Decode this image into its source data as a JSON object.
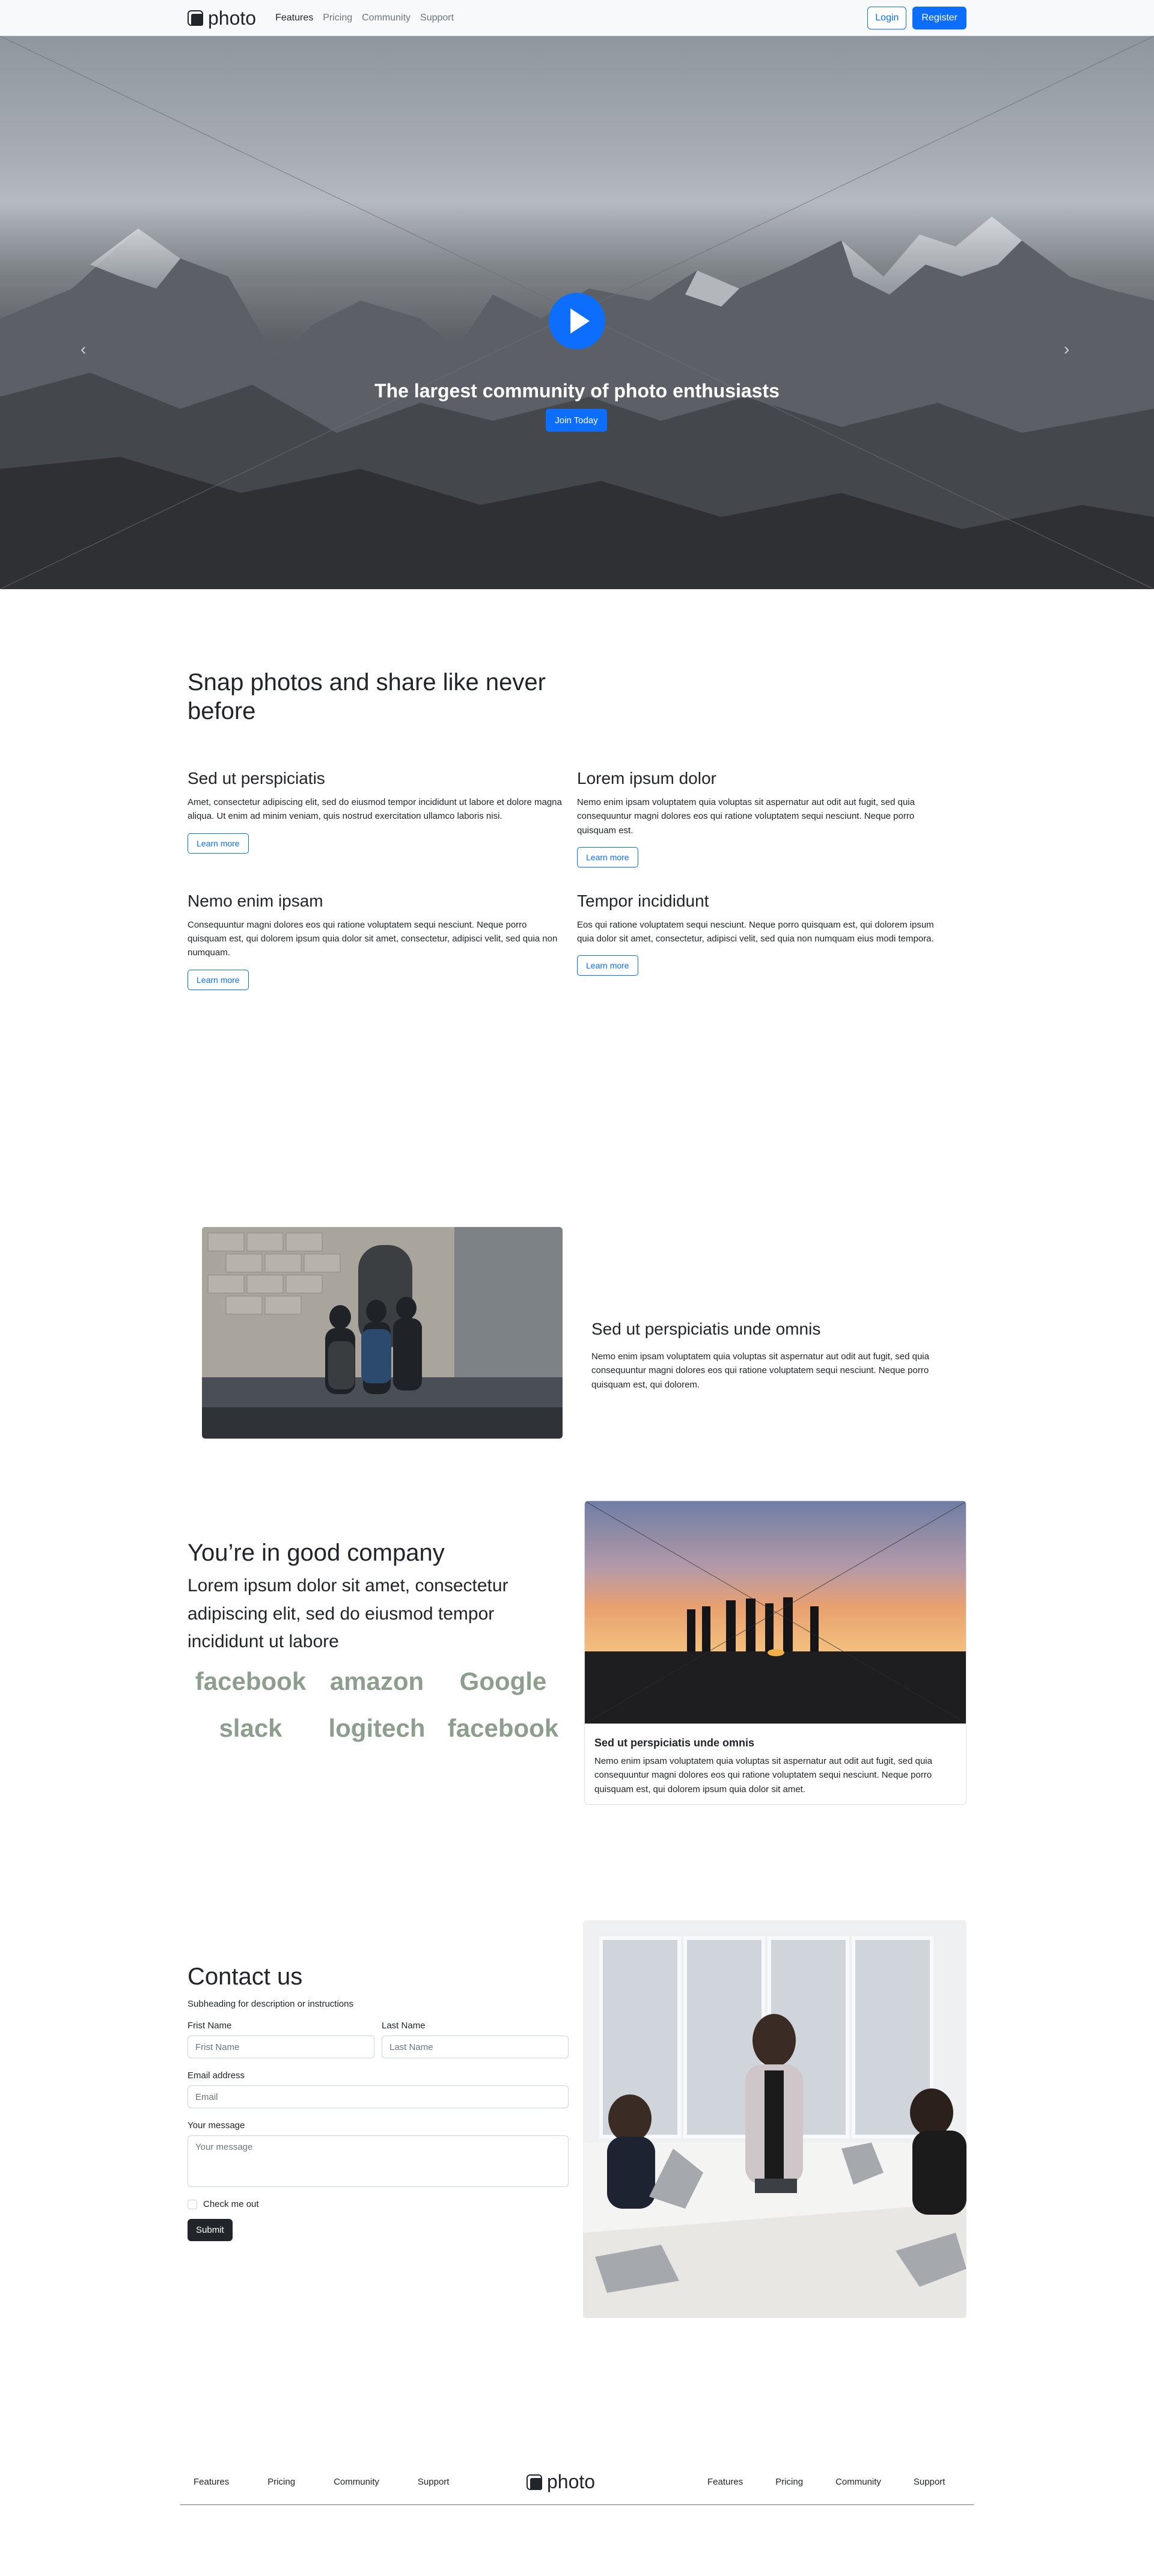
{
  "nav": {
    "brand": "photo",
    "links": [
      {
        "label": "Features",
        "active": true
      },
      {
        "label": "Pricing",
        "active": false
      },
      {
        "label": "Community",
        "active": false
      },
      {
        "label": "Support",
        "active": false
      }
    ],
    "login": "Login",
    "register": "Register"
  },
  "hero": {
    "title": "The largest community of photo enthusiasts",
    "cta": "Join Today",
    "prev_icon": "chevron-left-icon",
    "next_icon": "chevron-right-icon",
    "slides": 3,
    "active_slide": 1,
    "accent": "#0d6efd"
  },
  "features": {
    "heading": "Snap photos and share like never before",
    "items": [
      {
        "title": "Sed ut perspiciatis",
        "text": "Amet, consectetur adipiscing elit, sed do eiusmod tempor incididunt ut labore et dolore magna aliqua. Ut enim ad minim veniam, quis nostrud exercitation ullamco laboris nisi.",
        "button": "Learn more"
      },
      {
        "title": "Lorem ipsum dolor",
        "text": "Nemo enim ipsam voluptatem quia voluptas sit aspernatur aut odit aut fugit, sed quia consequuntur magni dolores eos qui ratione voluptatem sequi nesciunt. Neque porro quisquam est.",
        "button": "Learn more"
      },
      {
        "title": "Nemo enim ipsam",
        "text": "Consequuntur magni dolores eos qui ratione voluptatem sequi nesciunt. Neque porro quisquam est, qui dolorem ipsum quia dolor sit amet, consectetur, adipisci velit, sed quia non numquam.",
        "button": "Learn more"
      },
      {
        "title": "Tempor incididunt",
        "text": "Eos qui ratione voluptatem sequi nesciunt. Neque porro quisquam est, qui dolorem ipsum quia dolor sit amet, consectetur, adipisci velit, sed quia non numquam eius modi tempora.",
        "button": "Learn more"
      }
    ]
  },
  "featurette": {
    "title": "Sed ut perspiciatis unde omnis",
    "text": "Nemo enim ipsam voluptatem quia voluptas sit aspernatur aut odit aut fugit, sed quia consequuntur magni dolores eos qui ratione voluptatem sequi nesciunt. Neque porro quisquam est, qui dolorem."
  },
  "company": {
    "heading": "You’re in good company",
    "lead": "Lorem ipsum dolor sit amet, consectetur adipiscing elit, sed do eiusmod tempor incididunt ut labore",
    "logos": [
      "facebook",
      "amazon",
      "Google",
      "slack",
      "logitech",
      "facebook"
    ],
    "card": {
      "title": "Sed ut perspiciatis unde omnis",
      "text": "Nemo enim ipsam voluptatem quia voluptas sit aspernatur aut odit aut fugit, sed quia consequuntur magni dolores eos qui ratione voluptatem sequi nesciunt. Neque porro quisquam est, qui dolorem ipsum quia dolor sit amet."
    }
  },
  "contact": {
    "heading": "Contact us",
    "subheading": "Subheading for description or instructions",
    "first_label": "Frist Name",
    "first_placeholder": "Frist Name",
    "last_label": "Last Name",
    "last_placeholder": "Last Name",
    "email_label": "Email address",
    "email_placeholder": "Email",
    "message_label": "Your message",
    "message_placeholder": "Your message",
    "check_label": "Check me out",
    "submit": "Submit"
  },
  "footer": {
    "brand": "photo",
    "links_left": [
      "Features",
      "Pricing",
      "Community",
      "Support"
    ],
    "links_right": [
      "Features",
      "Pricing",
      "Community",
      "Support"
    ]
  }
}
